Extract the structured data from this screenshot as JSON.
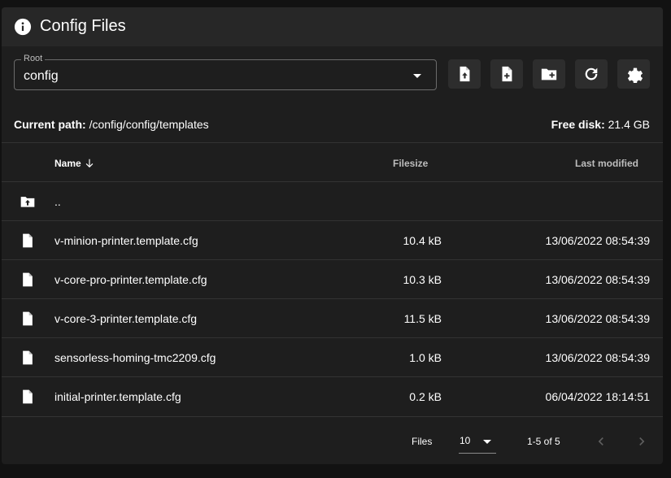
{
  "header": {
    "title": "Config Files",
    "icon": "info-icon"
  },
  "root": {
    "label": "Root",
    "value": "config"
  },
  "toolbar": {
    "buttons": [
      {
        "name": "upload-file-button",
        "icon": "file-upload-icon"
      },
      {
        "name": "create-file-button",
        "icon": "file-plus-icon"
      },
      {
        "name": "create-folder-button",
        "icon": "folder-plus-icon"
      },
      {
        "name": "refresh-button",
        "icon": "refresh-icon"
      },
      {
        "name": "settings-button",
        "icon": "gear-icon"
      }
    ]
  },
  "path": {
    "label": "Current path:",
    "value": "/config/config/templates"
  },
  "disk": {
    "label": "Free disk:",
    "value": "21.4 GB"
  },
  "table": {
    "columns": {
      "name": "Name",
      "size": "Filesize",
      "modified": "Last modified"
    },
    "parent": "..",
    "rows": [
      {
        "name": "v-minion-printer.template.cfg",
        "size": "10.4 kB",
        "modified": "13/06/2022 08:54:39"
      },
      {
        "name": "v-core-pro-printer.template.cfg",
        "size": "10.3 kB",
        "modified": "13/06/2022 08:54:39"
      },
      {
        "name": "v-core-3-printer.template.cfg",
        "size": "11.5 kB",
        "modified": "13/06/2022 08:54:39"
      },
      {
        "name": "sensorless-homing-tmc2209.cfg",
        "size": "1.0 kB",
        "modified": "13/06/2022 08:54:39"
      },
      {
        "name": "initial-printer.template.cfg",
        "size": "0.2 kB",
        "modified": "06/04/2022 18:14:51"
      }
    ]
  },
  "footer": {
    "per_page_label": "Files",
    "per_page_value": "10",
    "range": "1-5 of 5"
  },
  "colors": {
    "background": "#121212",
    "card": "#1e1e1e",
    "header": "#272727",
    "button": "#2d2d2d"
  }
}
